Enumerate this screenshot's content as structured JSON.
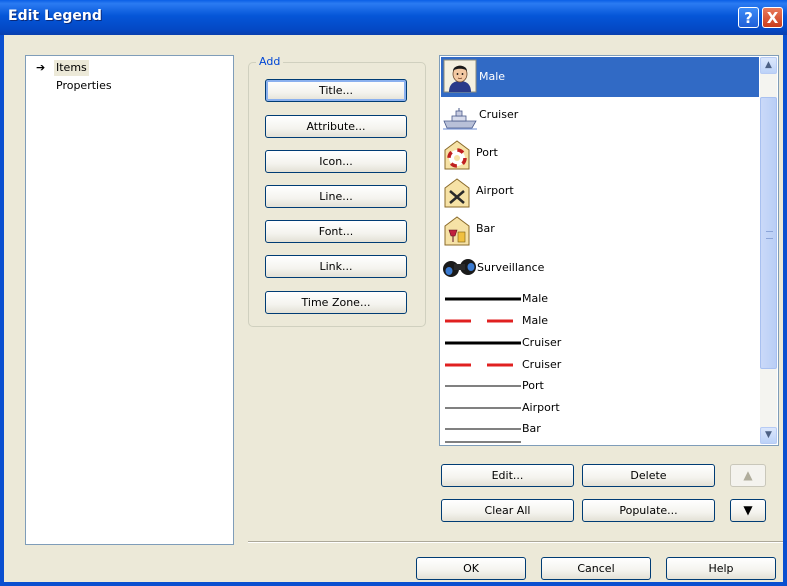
{
  "window": {
    "title": "Edit Legend",
    "help_glyph": "?",
    "close_glyph": "X"
  },
  "tree": {
    "items": [
      {
        "label": "Items",
        "selected": true,
        "arrow": "➔"
      },
      {
        "label": "Properties",
        "selected": false
      }
    ]
  },
  "add_group": {
    "label": "Add",
    "buttons": [
      "Title...",
      "Attribute...",
      "Icon...",
      "Line...",
      "Font...",
      "Link...",
      "Time Zone..."
    ]
  },
  "legend_items": {
    "icons": [
      {
        "label": "Male",
        "icon": "male-person-icon",
        "selected": true
      },
      {
        "label": "Cruiser",
        "icon": "cruiser-ship-icon"
      },
      {
        "label": "Port",
        "icon": "port-lifebuoy-icon"
      },
      {
        "label": "Airport",
        "icon": "airport-icon"
      },
      {
        "label": "Bar",
        "icon": "bar-drinks-icon"
      },
      {
        "label": "Surveillance",
        "icon": "binoculars-icon"
      }
    ],
    "lines": [
      {
        "label": "Male",
        "style": "solid-thick",
        "color": "#000000"
      },
      {
        "label": "Male",
        "style": "dashed-thick",
        "color": "#e02020"
      },
      {
        "label": "Cruiser",
        "style": "solid-thick",
        "color": "#000000"
      },
      {
        "label": "Cruiser",
        "style": "dashed-thick",
        "color": "#e02020"
      },
      {
        "label": "Port",
        "style": "solid-thin",
        "color": "#000000"
      },
      {
        "label": "Airport",
        "style": "solid-thin",
        "color": "#000000"
      },
      {
        "label": "Bar",
        "style": "solid-thin",
        "color": "#000000"
      }
    ]
  },
  "list_actions": {
    "edit": "Edit...",
    "delete": "Delete",
    "clear_all": "Clear All",
    "populate": "Populate...",
    "move_up_glyph": "▲",
    "move_down_glyph": "▼"
  },
  "dialog_buttons": {
    "ok": "OK",
    "cancel": "Cancel",
    "help": "Help"
  },
  "colors": {
    "selection": "#316ac5",
    "titlebar": "#0556d8",
    "group_label": "#0046d5"
  }
}
